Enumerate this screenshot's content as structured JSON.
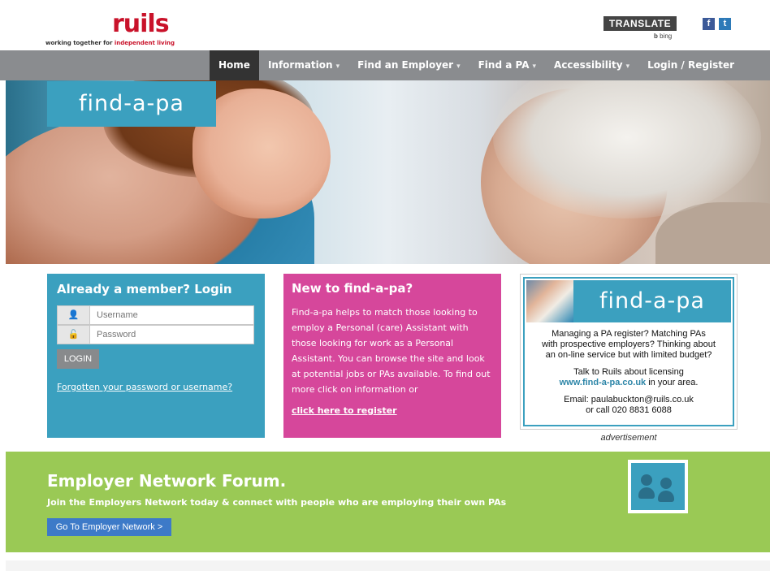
{
  "header": {
    "logo_word": "ruils",
    "logo_tagline_prefix": "working together for ",
    "logo_tagline_highlight": "independent living",
    "translate_label": "TRANSLATE",
    "bing_label": "bing",
    "facebook_glyph": "f",
    "twitter_glyph": "t"
  },
  "nav": {
    "items": [
      {
        "label": "Home",
        "caret": ""
      },
      {
        "label": "Information",
        "caret": "▾"
      },
      {
        "label": "Find an Employer",
        "caret": "▾"
      },
      {
        "label": "Find a PA",
        "caret": "▾"
      },
      {
        "label": "Accessibility",
        "caret": "▾"
      },
      {
        "label": "Login / Register",
        "caret": ""
      }
    ]
  },
  "hero": {
    "label": "find-a-pa"
  },
  "login": {
    "title": "Already a member? Login",
    "username_placeholder": "Username",
    "password_placeholder": "Password",
    "user_icon": "👤",
    "lock_icon": "🔓",
    "button_label": "LOGIN",
    "forgot_link": "Forgotten your password or username?"
  },
  "new_panel": {
    "title": "New to find-a-pa?",
    "body": "Find-a-pa helps to match those looking to employ a Personal (care) Assistant with those looking for work as a Personal Assistant. You can browse the site and look at potential jobs or PAs available. To find out more click on information or",
    "register_link": "click here to register"
  },
  "ad": {
    "band_text": "find-a-pa",
    "line1": "Managing a PA register? Matching PAs",
    "line2": "with prospective employers? Thinking about",
    "line3": "an on-line service but with limited budget?",
    "line4": "Talk to Ruils about licensing",
    "link": "www.find-a-pa.co.uk",
    "line5_suffix": " in your area.",
    "email_line": "Email: paulabuckton@ruils.co.uk",
    "phone_line": "or call 020 8831 6088",
    "caption": "advertisement"
  },
  "forum": {
    "title": "Employer Network Forum.",
    "subtitle": "Join the Employers Network today & connect with people who are employing their own PAs",
    "button_label": "Go To Employer Network >"
  },
  "colors": {
    "brand_red": "#c9122a",
    "nav_gray": "#8a8c8f",
    "teal": "#3ba0bf",
    "magenta": "#d6479b",
    "green": "#9ac955",
    "button_blue": "#3d7ac8"
  }
}
